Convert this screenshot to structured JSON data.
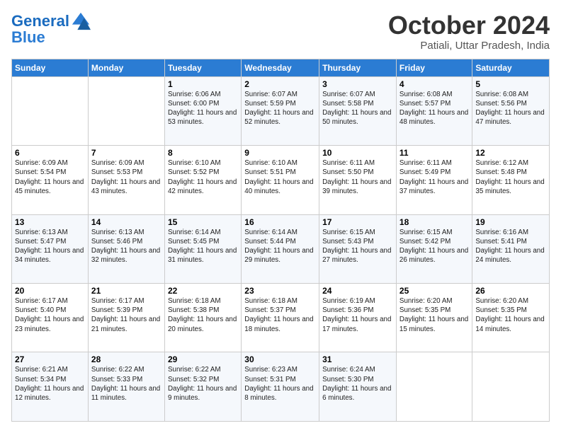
{
  "header": {
    "logo_line1": "General",
    "logo_line2": "Blue",
    "month": "October 2024",
    "location": "Patiali, Uttar Pradesh, India"
  },
  "days_of_week": [
    "Sunday",
    "Monday",
    "Tuesday",
    "Wednesday",
    "Thursday",
    "Friday",
    "Saturday"
  ],
  "weeks": [
    [
      {
        "day": "",
        "info": ""
      },
      {
        "day": "",
        "info": ""
      },
      {
        "day": "1",
        "info": "Sunrise: 6:06 AM\nSunset: 6:00 PM\nDaylight: 11 hours and 53 minutes."
      },
      {
        "day": "2",
        "info": "Sunrise: 6:07 AM\nSunset: 5:59 PM\nDaylight: 11 hours and 52 minutes."
      },
      {
        "day": "3",
        "info": "Sunrise: 6:07 AM\nSunset: 5:58 PM\nDaylight: 11 hours and 50 minutes."
      },
      {
        "day": "4",
        "info": "Sunrise: 6:08 AM\nSunset: 5:57 PM\nDaylight: 11 hours and 48 minutes."
      },
      {
        "day": "5",
        "info": "Sunrise: 6:08 AM\nSunset: 5:56 PM\nDaylight: 11 hours and 47 minutes."
      }
    ],
    [
      {
        "day": "6",
        "info": "Sunrise: 6:09 AM\nSunset: 5:54 PM\nDaylight: 11 hours and 45 minutes."
      },
      {
        "day": "7",
        "info": "Sunrise: 6:09 AM\nSunset: 5:53 PM\nDaylight: 11 hours and 43 minutes."
      },
      {
        "day": "8",
        "info": "Sunrise: 6:10 AM\nSunset: 5:52 PM\nDaylight: 11 hours and 42 minutes."
      },
      {
        "day": "9",
        "info": "Sunrise: 6:10 AM\nSunset: 5:51 PM\nDaylight: 11 hours and 40 minutes."
      },
      {
        "day": "10",
        "info": "Sunrise: 6:11 AM\nSunset: 5:50 PM\nDaylight: 11 hours and 39 minutes."
      },
      {
        "day": "11",
        "info": "Sunrise: 6:11 AM\nSunset: 5:49 PM\nDaylight: 11 hours and 37 minutes."
      },
      {
        "day": "12",
        "info": "Sunrise: 6:12 AM\nSunset: 5:48 PM\nDaylight: 11 hours and 35 minutes."
      }
    ],
    [
      {
        "day": "13",
        "info": "Sunrise: 6:13 AM\nSunset: 5:47 PM\nDaylight: 11 hours and 34 minutes."
      },
      {
        "day": "14",
        "info": "Sunrise: 6:13 AM\nSunset: 5:46 PM\nDaylight: 11 hours and 32 minutes."
      },
      {
        "day": "15",
        "info": "Sunrise: 6:14 AM\nSunset: 5:45 PM\nDaylight: 11 hours and 31 minutes."
      },
      {
        "day": "16",
        "info": "Sunrise: 6:14 AM\nSunset: 5:44 PM\nDaylight: 11 hours and 29 minutes."
      },
      {
        "day": "17",
        "info": "Sunrise: 6:15 AM\nSunset: 5:43 PM\nDaylight: 11 hours and 27 minutes."
      },
      {
        "day": "18",
        "info": "Sunrise: 6:15 AM\nSunset: 5:42 PM\nDaylight: 11 hours and 26 minutes."
      },
      {
        "day": "19",
        "info": "Sunrise: 6:16 AM\nSunset: 5:41 PM\nDaylight: 11 hours and 24 minutes."
      }
    ],
    [
      {
        "day": "20",
        "info": "Sunrise: 6:17 AM\nSunset: 5:40 PM\nDaylight: 11 hours and 23 minutes."
      },
      {
        "day": "21",
        "info": "Sunrise: 6:17 AM\nSunset: 5:39 PM\nDaylight: 11 hours and 21 minutes."
      },
      {
        "day": "22",
        "info": "Sunrise: 6:18 AM\nSunset: 5:38 PM\nDaylight: 11 hours and 20 minutes."
      },
      {
        "day": "23",
        "info": "Sunrise: 6:18 AM\nSunset: 5:37 PM\nDaylight: 11 hours and 18 minutes."
      },
      {
        "day": "24",
        "info": "Sunrise: 6:19 AM\nSunset: 5:36 PM\nDaylight: 11 hours and 17 minutes."
      },
      {
        "day": "25",
        "info": "Sunrise: 6:20 AM\nSunset: 5:35 PM\nDaylight: 11 hours and 15 minutes."
      },
      {
        "day": "26",
        "info": "Sunrise: 6:20 AM\nSunset: 5:35 PM\nDaylight: 11 hours and 14 minutes."
      }
    ],
    [
      {
        "day": "27",
        "info": "Sunrise: 6:21 AM\nSunset: 5:34 PM\nDaylight: 11 hours and 12 minutes."
      },
      {
        "day": "28",
        "info": "Sunrise: 6:22 AM\nSunset: 5:33 PM\nDaylight: 11 hours and 11 minutes."
      },
      {
        "day": "29",
        "info": "Sunrise: 6:22 AM\nSunset: 5:32 PM\nDaylight: 11 hours and 9 minutes."
      },
      {
        "day": "30",
        "info": "Sunrise: 6:23 AM\nSunset: 5:31 PM\nDaylight: 11 hours and 8 minutes."
      },
      {
        "day": "31",
        "info": "Sunrise: 6:24 AM\nSunset: 5:30 PM\nDaylight: 11 hours and 6 minutes."
      },
      {
        "day": "",
        "info": ""
      },
      {
        "day": "",
        "info": ""
      }
    ]
  ]
}
